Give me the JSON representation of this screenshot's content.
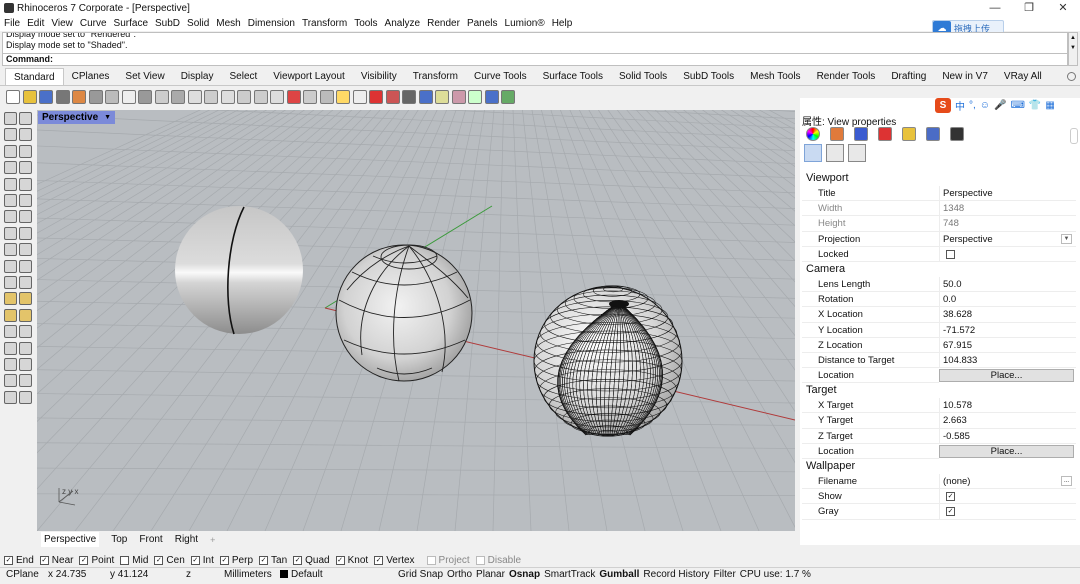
{
  "window": {
    "title": "Rhinoceros 7 Corporate - [Perspective]",
    "controls": [
      "—",
      "❐",
      "✕"
    ]
  },
  "menu": [
    "File",
    "Edit",
    "View",
    "Curve",
    "Surface",
    "SubD",
    "Solid",
    "Mesh",
    "Dimension",
    "Transform",
    "Tools",
    "Analyze",
    "Render",
    "Panels",
    "Lumion®",
    "Help"
  ],
  "upload_button": "拖拽上传",
  "history": [
    "Display mode set to \"Rendered\".",
    "Display mode set to \"Shaded\"."
  ],
  "command_label": "Command:",
  "toolbar_tabs": [
    "Standard",
    "CPlanes",
    "Set View",
    "Display",
    "Select",
    "Viewport Layout",
    "Visibility",
    "Transform",
    "Curve Tools",
    "Surface Tools",
    "Solid Tools",
    "SubD Tools",
    "Mesh Tools",
    "Render Tools",
    "Drafting",
    "New in V7",
    "VRay All"
  ],
  "viewport": {
    "title": "Perspective",
    "bg_color": "#b9bdc1",
    "grid_color": "#a6aaae",
    "x_axis_color": "#b03a3a",
    "y_axis_color": "#3a9a3a",
    "axes_label": "z y x"
  },
  "viewport_tabs": [
    "Perspective",
    "Top",
    "Front",
    "Right",
    "+"
  ],
  "ime": {
    "logo": "S",
    "items": [
      "中",
      "°,",
      "☺",
      "🎤",
      "⌨",
      "👕",
      "▦"
    ]
  },
  "properties": {
    "header": "属性: View properties",
    "sections": [
      {
        "title": "Viewport",
        "rows": [
          {
            "label": "Title",
            "value": "Perspective"
          },
          {
            "label": "Width",
            "value": "1348",
            "disabled": true
          },
          {
            "label": "Height",
            "value": "748",
            "disabled": true
          },
          {
            "label": "Projection",
            "value": "Perspective",
            "dropdown": true
          },
          {
            "label": "Locked",
            "checkbox": false
          }
        ]
      },
      {
        "title": "Camera",
        "rows": [
          {
            "label": "Lens Length",
            "value": "50.0"
          },
          {
            "label": "Rotation",
            "value": "0.0"
          },
          {
            "label": "X Location",
            "value": "38.628"
          },
          {
            "label": "Y Location",
            "value": "-71.572"
          },
          {
            "label": "Z Location",
            "value": "67.915"
          },
          {
            "label": "Distance to Target",
            "value": "104.833"
          },
          {
            "label": "Location",
            "button": "Place..."
          }
        ]
      },
      {
        "title": "Target",
        "rows": [
          {
            "label": "X Target",
            "value": "10.578"
          },
          {
            "label": "Y Target",
            "value": "2.663"
          },
          {
            "label": "Z Target",
            "value": "-0.585"
          },
          {
            "label": "Location",
            "button": "Place..."
          }
        ]
      },
      {
        "title": "Wallpaper",
        "rows": [
          {
            "label": "Filename",
            "value": "(none)",
            "more": true
          },
          {
            "label": "Show",
            "checkbox": true
          },
          {
            "label": "Gray",
            "checkbox": true
          }
        ]
      }
    ]
  },
  "osnaps": [
    {
      "label": "End",
      "checked": true
    },
    {
      "label": "Near",
      "checked": true
    },
    {
      "label": "Point",
      "checked": true
    },
    {
      "label": "Mid",
      "checked": false
    },
    {
      "label": "Cen",
      "checked": true
    },
    {
      "label": "Int",
      "checked": true
    },
    {
      "label": "Perp",
      "checked": true
    },
    {
      "label": "Tan",
      "checked": true
    },
    {
      "label": "Quad",
      "checked": true
    },
    {
      "label": "Knot",
      "checked": true
    },
    {
      "label": "Vertex",
      "checked": true
    },
    {
      "label": "Project",
      "checked": false,
      "disabled": true
    },
    {
      "label": "Disable",
      "checked": false,
      "disabled": true
    }
  ],
  "status": {
    "cplane": "CPlane",
    "x": "x 24.735",
    "y": "y 41.124",
    "z": "z",
    "units": "Millimeters",
    "layer": "Default",
    "toggles": [
      {
        "label": "Grid Snap",
        "bold": false
      },
      {
        "label": "Ortho",
        "bold": false
      },
      {
        "label": "Planar",
        "bold": false
      },
      {
        "label": "Osnap",
        "bold": true
      },
      {
        "label": "SmartTrack",
        "bold": false
      },
      {
        "label": "Gumball",
        "bold": true
      },
      {
        "label": "Record History",
        "bold": false
      },
      {
        "label": "Filter",
        "bold": false
      }
    ],
    "cpu": "CPU use: 1.7 %"
  }
}
